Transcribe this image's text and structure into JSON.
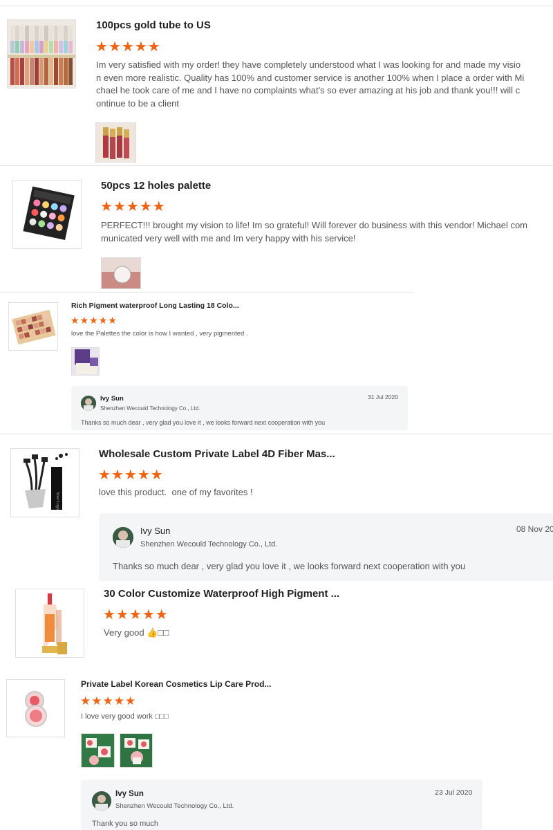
{
  "reviews": [
    {
      "title": "100pcs gold tube to US",
      "rating": 5,
      "text": "Im very satisfied with my order! they have completely understood what I was looking for and made my vision even more realistic. Quality has 100% and customer service is another 100% when I place a order with Michael he took care of me and I have no complaints what's so ever amazing at his job and thank you!!! will continue to be a client",
      "text_lines": [
        "Im very satisfied with my order! they have completely understood what I was looking for and made my visio",
        "n even more realistic. Quality has 100% and customer service is another 100% when I place a order with Mi",
        "chael he took care of me and I have no complaints what's so ever amazing at his job and thank you!!! will c",
        "ontinue to be a client"
      ]
    },
    {
      "title": "50pcs 12 holes palette",
      "rating": 5,
      "text_lines": [
        "PERFECT!!! brought my vision to life! Im so grateful! Will forever do business with this vendor! Michael com",
        "municated very well with me and Im very happy with his service!"
      ]
    },
    {
      "title": "Rich Pigment waterproof Long Lasting 18 Colo...",
      "rating": 5,
      "text": "love the Palettes the color is how I wanted , very pigmented .",
      "reply": {
        "name": "Ivy Sun",
        "company": "Shenzhen Wecould Technology Co., Ltd.",
        "date": "31 Jul 2020",
        "text": "Thanks so much dear , very glad you love it , we looks forward next cooperation with you"
      }
    },
    {
      "title": "Wholesale Custom Private Label 4D Fiber Mas...",
      "rating": 5,
      "text": "love this product.  one of my favorites !",
      "reply": {
        "name": "Ivy Sun",
        "company": "Shenzhen Wecould Technology Co., Ltd.",
        "date": "08 Nov 20",
        "text": "Thanks so much dear , very glad you love it , we looks forward next cooperation with you"
      }
    },
    {
      "title": "30 Color Customize Waterproof High Pigment ...",
      "rating": 5,
      "text": "Very good 👍□□"
    },
    {
      "title": "Private Label Korean Cosmetics Lip Care Prod...",
      "rating": 5,
      "text": "I love very good work □□□",
      "reply": {
        "name": "Ivy Sun",
        "company": "Shenzhen Wecould Technology Co., Ltd.",
        "date": "23 Jul 2020",
        "text": "Thank you so much"
      }
    }
  ],
  "colors": {
    "star": "#f5620f",
    "reply_bg": "#f4f5f7",
    "divider": "#e3e3e3"
  },
  "icons": {
    "star": "star-icon",
    "avatar": "avatar"
  }
}
